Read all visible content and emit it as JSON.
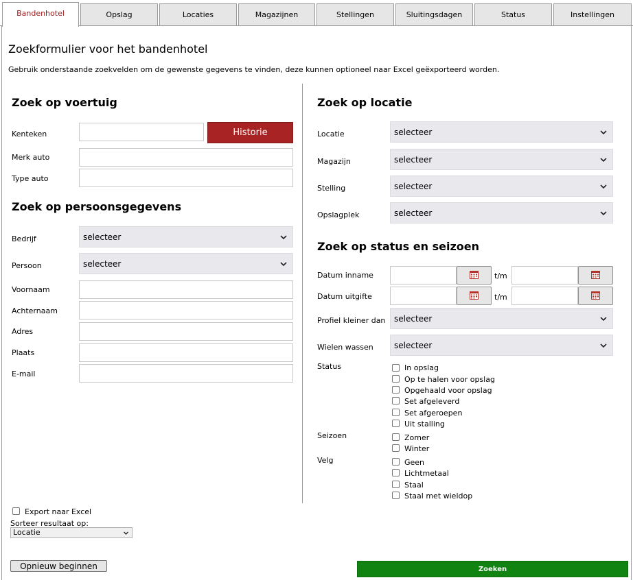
{
  "tabs": [
    {
      "label": "Bandenhotel",
      "active": true
    },
    {
      "label": "Opslag"
    },
    {
      "label": "Locaties"
    },
    {
      "label": "Magazijnen"
    },
    {
      "label": "Stellingen"
    },
    {
      "label": "Sluitingsdagen"
    },
    {
      "label": "Status"
    },
    {
      "label": "Instellingen"
    }
  ],
  "header": {
    "title": "Zoekformulier voor het bandenhotel",
    "description": "Gebruik onderstaande zoekvelden om de gewenste gegevens te vinden, deze kunnen optioneel naar Excel geëxporteerd worden."
  },
  "vehicle": {
    "title": "Zoek op voertuig",
    "kenteken_label": "Kenteken",
    "historie_label": "Historie",
    "merk_label": "Merk auto",
    "type_label": "Type auto"
  },
  "person": {
    "title": "Zoek op persoonsgegevens",
    "bedrijf_label": "Bedrijf",
    "persoon_label": "Persoon",
    "voornaam_label": "Voornaam",
    "achternaam_label": "Achternaam",
    "adres_label": "Adres",
    "plaats_label": "Plaats",
    "email_label": "E-mail"
  },
  "location": {
    "title": "Zoek op locatie",
    "locatie_label": "Locatie",
    "magazijn_label": "Magazijn",
    "stelling_label": "Stelling",
    "opslagplek_label": "Opslagplek"
  },
  "status_season": {
    "title": "Zoek op status en seizoen",
    "datum_inname_label": "Datum inname",
    "datum_uitgifte_label": "Datum uitgifte",
    "tm": "t/m",
    "profiel_label": "Profiel kleiner dan",
    "wielen_label": "Wielen wassen",
    "status_label": "Status",
    "status_options": [
      "In opslag",
      "Op te halen voor opslag",
      "Opgehaald voor opslag",
      "Set afgeleverd",
      "Set afgeroepen",
      "Uit stalling"
    ],
    "seizoen_label": "Seizoen",
    "seizoen_options": [
      "Zomer",
      "Winter"
    ],
    "velg_label": "Velg",
    "velg_options": [
      "Geen",
      "Lichtmetaal",
      "Staal",
      "Staal met wieldop"
    ]
  },
  "select_default": "selecteer",
  "footer": {
    "export_label": "Export naar Excel",
    "sort_label": "Sorteer resultaat op:",
    "sort_value": "Locatie",
    "reset_label": "Opnieuw beginnen",
    "search_label": "Zoeken"
  },
  "colors": {
    "accent_red": "#a82323",
    "search_green": "#118311",
    "calendar_icon": "#b5322b"
  }
}
